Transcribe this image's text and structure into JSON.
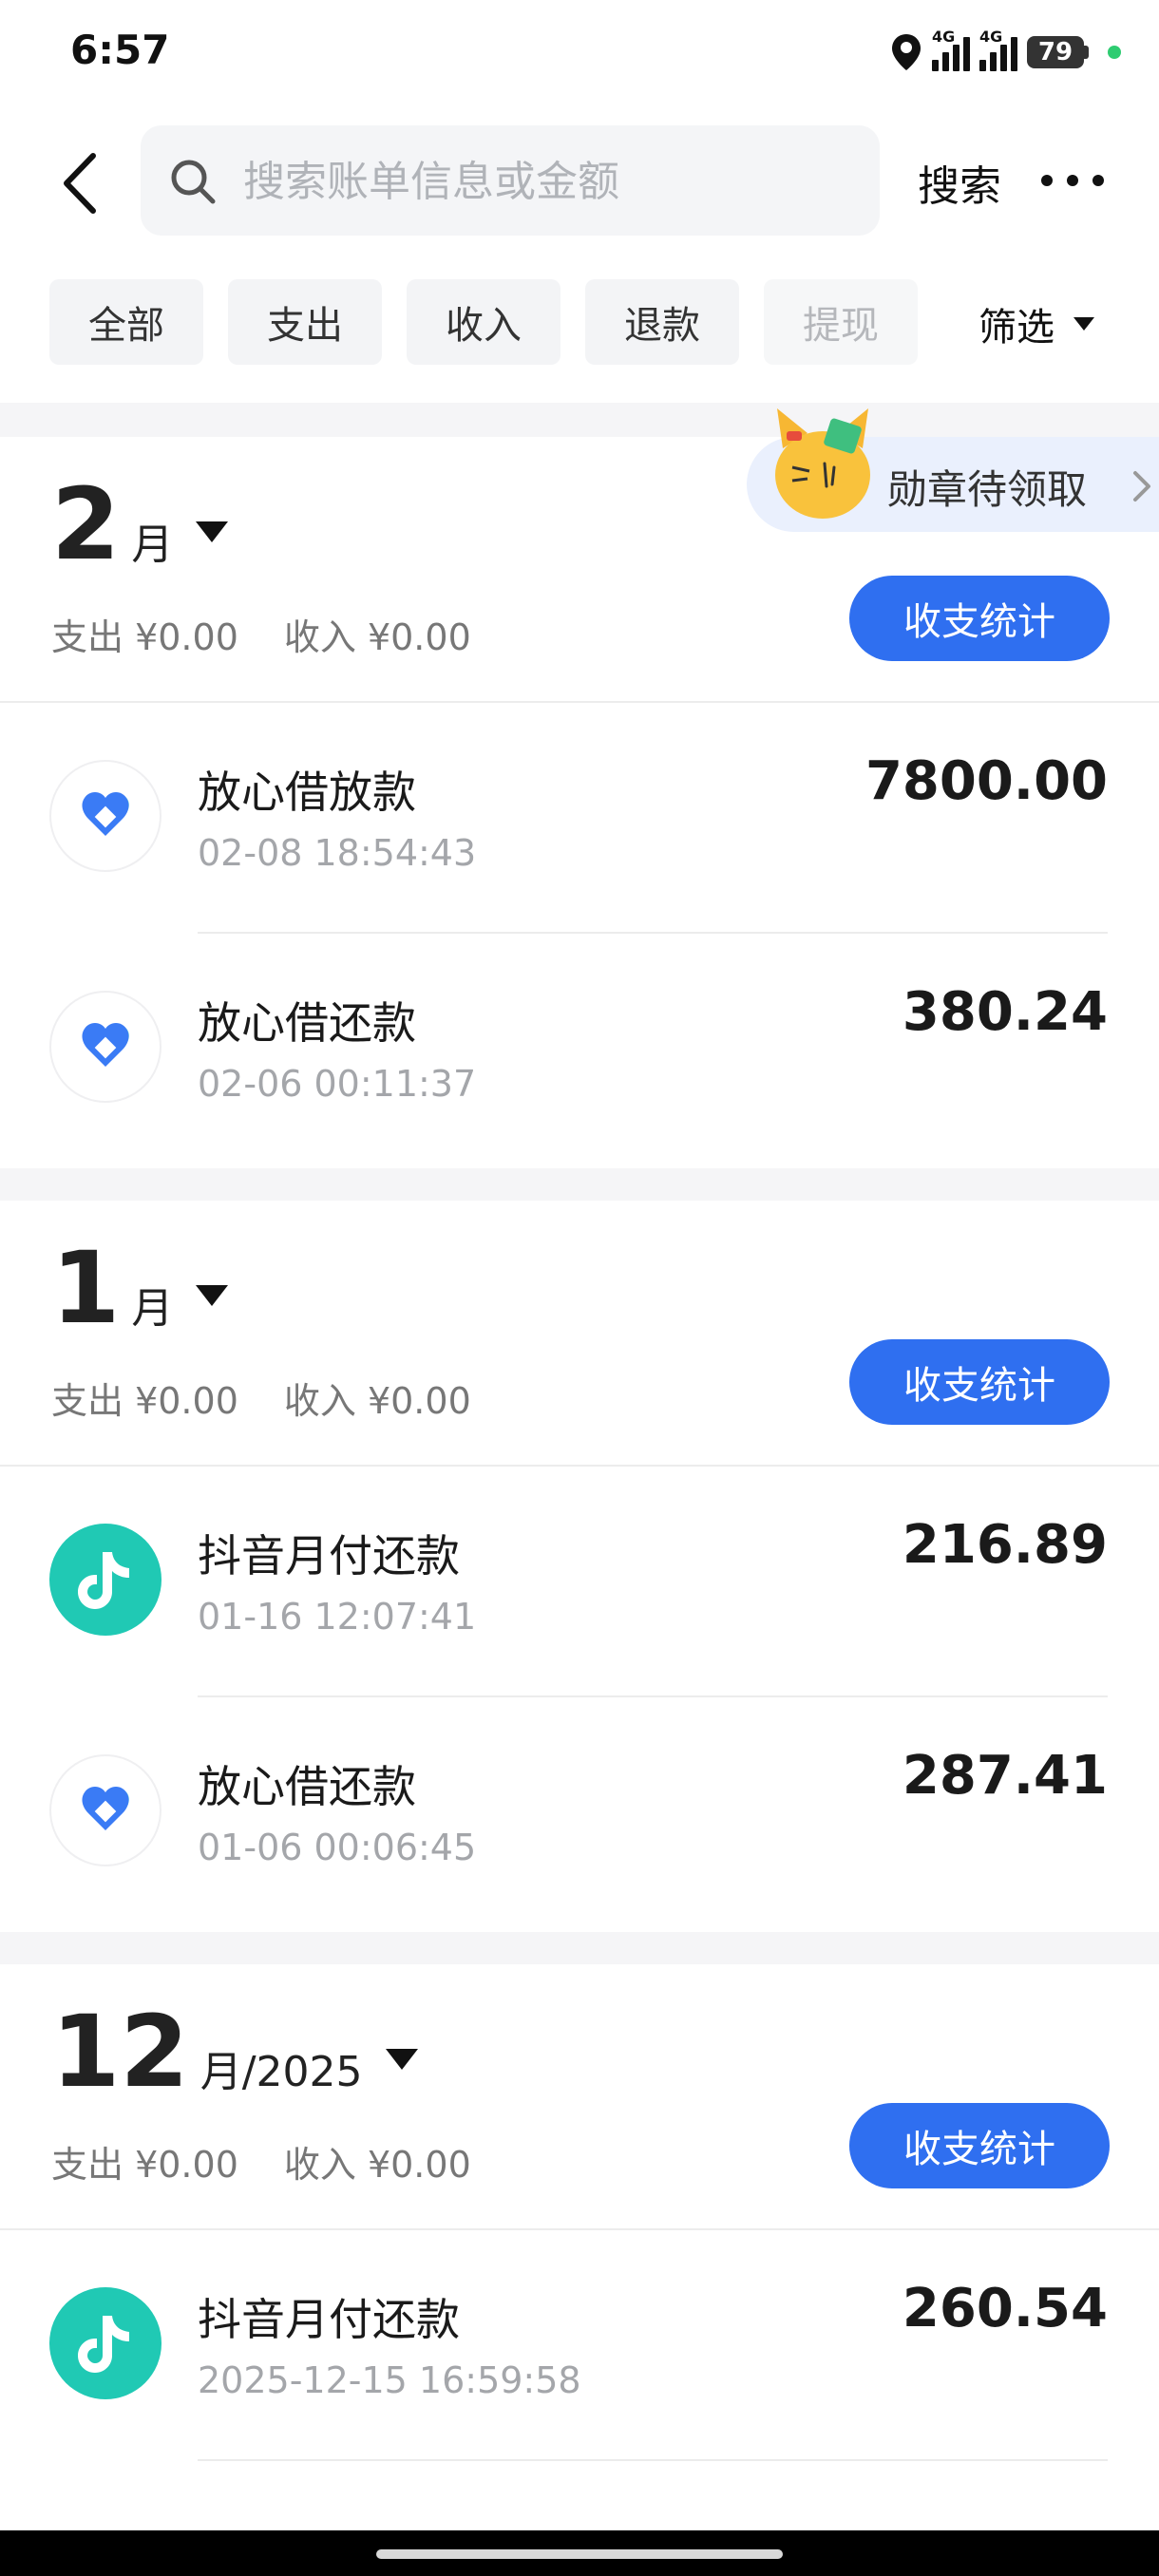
{
  "status_bar": {
    "time": "6:57",
    "network_1": "4G",
    "network_2": "4G",
    "battery": "79"
  },
  "header": {
    "search_placeholder": "搜索账单信息或金额",
    "search_label": "搜索"
  },
  "filters": {
    "chips": [
      "全部",
      "支出",
      "收入",
      "退款",
      "提现"
    ],
    "filter_label": "筛选"
  },
  "badge": {
    "label": "勋章待领取"
  },
  "months": [
    {
      "num": "2",
      "unit": "月",
      "expense": "支出 ¥0.00",
      "income": "收入 ¥0.00",
      "stats_label": "收支统计",
      "transactions": [
        {
          "name": "放心借放款",
          "datetime": "02-08 18:54:43",
          "amount": "7800.00",
          "icon": "loan-icon"
        },
        {
          "name": "放心借还款",
          "datetime": "02-06 00:11:37",
          "amount": "380.24",
          "icon": "loan-icon"
        }
      ]
    },
    {
      "num": "1",
      "unit": "月",
      "expense": "支出 ¥0.00",
      "income": "收入 ¥0.00",
      "stats_label": "收支统计",
      "transactions": [
        {
          "name": "抖音月付还款",
          "datetime": "01-16 12:07:41",
          "amount": "216.89",
          "icon": "douyin-icon"
        },
        {
          "name": "放心借还款",
          "datetime": "01-06 00:06:45",
          "amount": "287.41",
          "icon": "loan-icon"
        }
      ]
    },
    {
      "num": "12",
      "unit": "月/2025",
      "expense": "支出 ¥0.00",
      "income": "收入 ¥0.00",
      "stats_label": "收支统计",
      "transactions": [
        {
          "name": "抖音月付还款",
          "datetime": "2025-12-15 16:59:58",
          "amount": "260.54",
          "icon": "douyin-icon"
        }
      ]
    }
  ],
  "colors": {
    "accent": "#2f6ff0",
    "douyin": "#20c9b4",
    "loan_blue": "#3a7bf5",
    "loan_teal": "#7ee0d6"
  }
}
